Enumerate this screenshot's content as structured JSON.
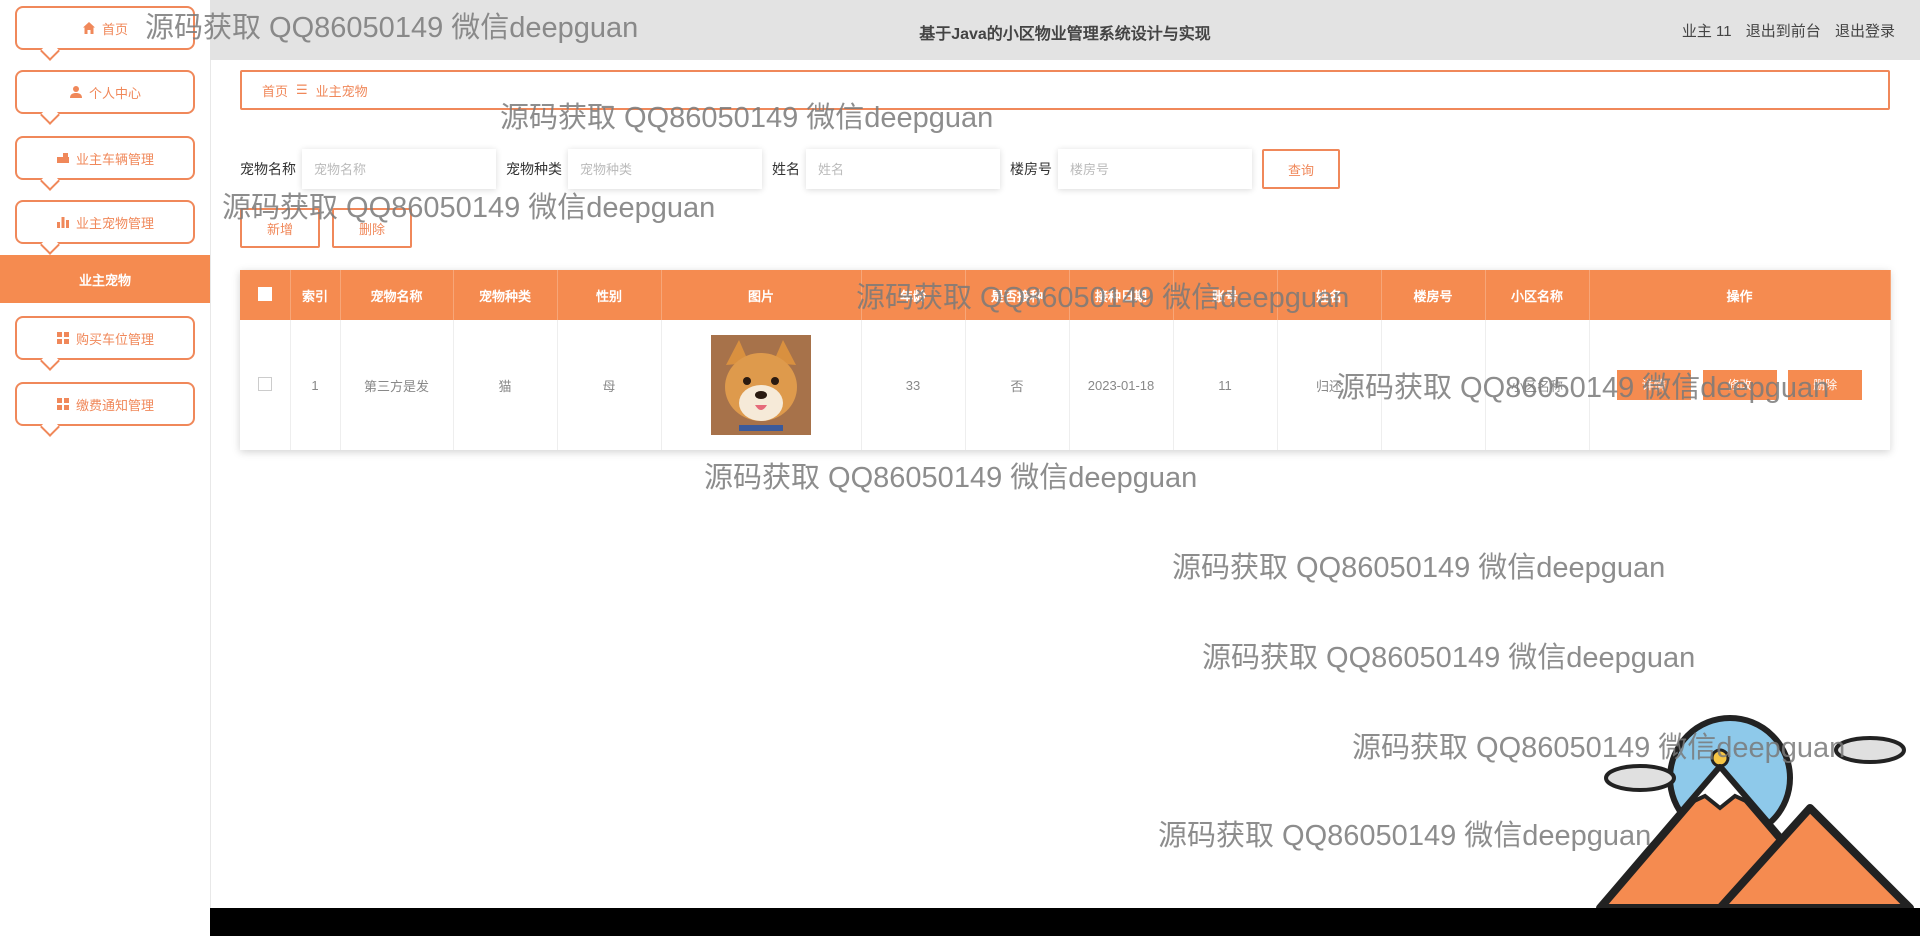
{
  "header": {
    "title": "基于Java的小区物业管理系统设计与实现",
    "user_label": "业主 11",
    "front_link": "退出到前台",
    "logout_link": "退出登录"
  },
  "sidebar": {
    "items": [
      {
        "label": "首页",
        "icon": "home-icon"
      },
      {
        "label": "个人中心",
        "icon": "user-icon"
      },
      {
        "label": "业主车辆管理",
        "icon": "car-icon"
      },
      {
        "label": "业主宠物管理",
        "icon": "bar-chart-icon"
      },
      {
        "label": "购买车位管理",
        "icon": "grid-icon"
      },
      {
        "label": "缴费通知管理",
        "icon": "grid-icon"
      }
    ],
    "active_sub": "业主宠物"
  },
  "breadcrumb": {
    "home": "首页",
    "sep": "☰",
    "current": "业主宠物"
  },
  "search": {
    "fields": [
      {
        "label": "宠物名称",
        "placeholder": "宠物名称"
      },
      {
        "label": "宠物种类",
        "placeholder": "宠物种类"
      },
      {
        "label": "姓名",
        "placeholder": "姓名"
      },
      {
        "label": "楼房号",
        "placeholder": "楼房号"
      }
    ],
    "query_label": "查询"
  },
  "actions": {
    "add_label": "新增",
    "delete_label": "删除"
  },
  "table": {
    "headers": [
      "索引",
      "宠物名称",
      "宠物种类",
      "性别",
      "图片",
      "年龄",
      "是否接种",
      "接种日期",
      "账号",
      "姓名",
      "楼房号",
      "小区名称",
      "操作"
    ],
    "rows": [
      {
        "index": "1",
        "name": "第三方是发",
        "kind": "猫",
        "gender": "母",
        "age": "33",
        "vaccinated": "否",
        "vaccine_date": "2023-01-18",
        "account": "11",
        "owner": "归还",
        "building": "",
        "community": "小区名称",
        "ops": [
          "详情",
          "修改",
          "删除"
        ]
      }
    ]
  },
  "watermark": "源码获取 QQ86050149 微信deepguan",
  "colors": {
    "accent": "#f58b50",
    "topbar": "#e3e3e3"
  }
}
